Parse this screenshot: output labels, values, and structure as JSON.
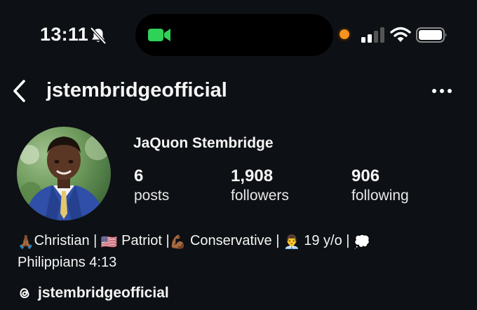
{
  "status_bar": {
    "time": "13:11",
    "icons": [
      "bell-slash-icon",
      "video-camera-icon",
      "recording-dot-icon",
      "cellular-signal-icon",
      "wifi-icon",
      "battery-icon"
    ],
    "accent_green": "#30d158",
    "recording_color": "#f6921e"
  },
  "header": {
    "username": "jstembridgeofficial",
    "back_icon": "chevron-left-icon",
    "more_icon": "ellipsis-icon"
  },
  "profile": {
    "full_name": "JaQuon Stembridge",
    "stats": [
      {
        "value": "6",
        "label": "posts"
      },
      {
        "value": "1,908",
        "label": "followers"
      },
      {
        "value": "906",
        "label": "following"
      }
    ],
    "bio": {
      "seg1": "Christian |",
      "seg2": "Patriot |",
      "seg3": "Conservative |",
      "seg4": "19 y/o |",
      "line2": "Philippians 4:13",
      "emojis": {
        "praying": "🙏🏾",
        "flag": "🇺🇸",
        "muscle": "💪🏾",
        "person": "👨‍💼",
        "thought": "💭"
      }
    },
    "threads_handle": "jstembridgeofficial"
  }
}
